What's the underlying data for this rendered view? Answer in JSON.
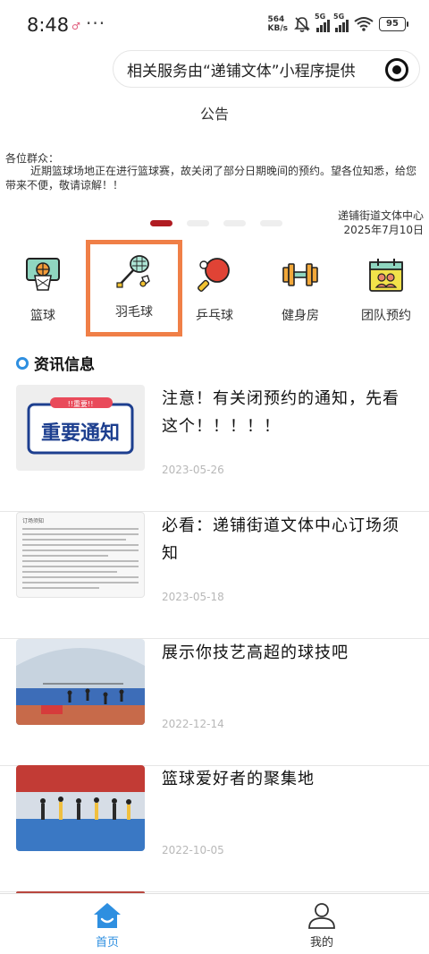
{
  "status_bar": {
    "time": "8:48",
    "notification": "♂",
    "dots": "···",
    "net_speed_value": "564",
    "net_speed_unit": "KB/s",
    "network1": "5G",
    "network2": "5G",
    "battery": "95"
  },
  "capsule": {
    "text": "相关服务由“递铺文体”小程序提供"
  },
  "notice": {
    "title": "公告",
    "greeting": "各位群众：",
    "body": "近期篮球场地正在进行篮球赛，故关闭了部分日期晚间的预约。望各位知悉，给您带来不便，敬请谅解！！",
    "org": "递铺街道文体中心",
    "date": "2025年7月10日",
    "carousel_active_index": 0,
    "carousel_count": 4
  },
  "categories": [
    {
      "label": "篮球",
      "icon": "basketball-hoop-icon"
    },
    {
      "label": "羽毛球",
      "icon": "badminton-icon",
      "selected": true
    },
    {
      "label": "乒乓球",
      "icon": "ping-pong-icon"
    },
    {
      "label": "健身房",
      "icon": "dumbbell-icon"
    },
    {
      "label": "团队预约",
      "icon": "team-calendar-icon"
    }
  ],
  "news_section": {
    "title": "资讯信息"
  },
  "news": [
    {
      "title": "注意！有关闭预约的通知，先看这个！！！！！",
      "date": "2023-05-26",
      "thumb_text": "重要通知"
    },
    {
      "title": "必看：递铺街道文体中心订场须知",
      "date": "2023-05-18",
      "thumb_text": "订场须知"
    },
    {
      "title": "展示你技艺高超的球技吧",
      "date": "2022-12-14"
    },
    {
      "title": "篮球爱好者的聚集地",
      "date": "2022-10-05"
    }
  ],
  "tabbar": {
    "home": "首页",
    "mine": "我的"
  },
  "colors": {
    "accent_blue": "#2e8fe0",
    "carousel_active": "#b01c22",
    "selected_border": "#f07f47"
  }
}
